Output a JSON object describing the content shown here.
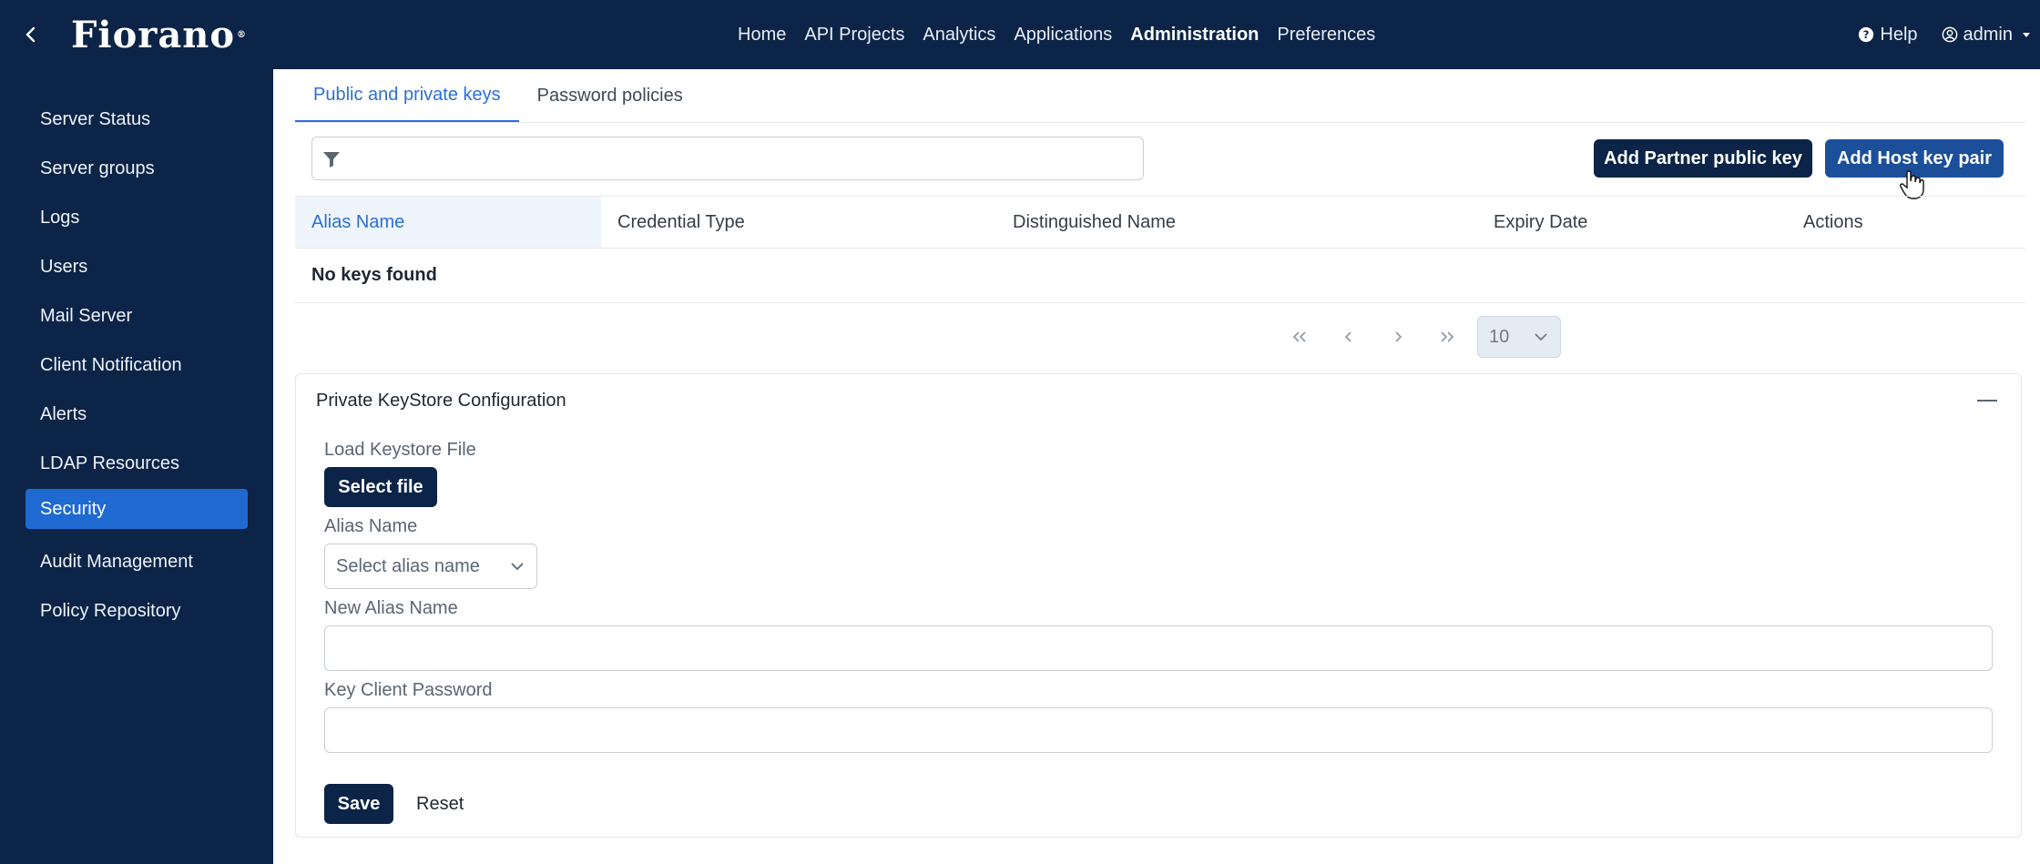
{
  "app": {
    "logo_text": "Fiorano",
    "logo_mark": "®",
    "back_icon": "chevron-left-icon"
  },
  "topnav": {
    "items": [
      {
        "label": "Home",
        "active": false
      },
      {
        "label": "API Projects",
        "active": false
      },
      {
        "label": "Analytics",
        "active": false
      },
      {
        "label": "Applications",
        "active": false
      },
      {
        "label": "Administration",
        "active": true
      },
      {
        "label": "Preferences",
        "active": false
      }
    ],
    "help_label": "Help",
    "user_label": "admin"
  },
  "sidebar": {
    "items": [
      {
        "label": "Server Status",
        "active": false
      },
      {
        "label": "Server groups",
        "active": false
      },
      {
        "label": "Logs",
        "active": false
      },
      {
        "label": "Users",
        "active": false
      },
      {
        "label": "Mail Server",
        "active": false
      },
      {
        "label": "Client Notification",
        "active": false
      },
      {
        "label": "Alerts",
        "active": false
      },
      {
        "label": "LDAP Resources",
        "active": false
      },
      {
        "label": "Security",
        "active": true
      },
      {
        "label": "Audit Management",
        "active": false
      },
      {
        "label": "Policy Repository",
        "active": false
      }
    ]
  },
  "tabs": [
    {
      "label": "Public and private keys",
      "active": true
    },
    {
      "label": "Password policies",
      "active": false
    }
  ],
  "filter": {
    "value": "",
    "placeholder": ""
  },
  "toolbar": {
    "add_partner_label": "Add Partner public key",
    "add_host_label": "Add Host key pair"
  },
  "table": {
    "columns": [
      "Alias Name",
      "Credential Type",
      "Distinguished Name",
      "Expiry Date",
      "Actions"
    ],
    "empty_message": "No keys found"
  },
  "pagination": {
    "page_size": "10"
  },
  "keystore": {
    "title": "Private KeyStore Configuration",
    "load_label": "Load Keystore File",
    "select_file_label": "Select file",
    "alias_label": "Alias Name",
    "alias_placeholder": "Select alias name",
    "new_alias_label": "New Alias Name",
    "new_alias_value": "",
    "password_label": "Key Client Password",
    "password_value": "",
    "save_label": "Save",
    "reset_label": "Reset"
  },
  "colors": {
    "brand_navy": "#0b2447",
    "accent_blue": "#1f6ad1",
    "link_blue": "#2a6fd6"
  }
}
